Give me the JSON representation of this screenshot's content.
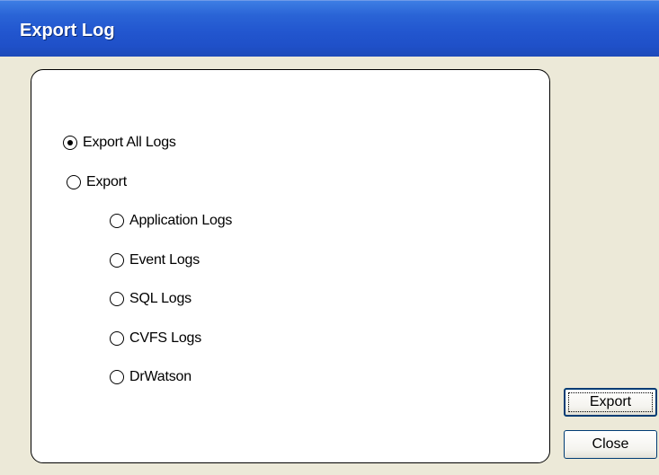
{
  "window": {
    "title": "Export Log"
  },
  "options": {
    "export_all_label": "Export All Logs",
    "export_label": "Export",
    "selected": "export_all",
    "sub_options": [
      {
        "label": "Application Logs",
        "checked": false
      },
      {
        "label": "Event Logs",
        "checked": false
      },
      {
        "label": "SQL Logs",
        "checked": false
      },
      {
        "label": "CVFS Logs",
        "checked": false
      },
      {
        "label": "DrWatson",
        "checked": false
      }
    ]
  },
  "buttons": {
    "export_label": "Export",
    "close_label": "Close"
  }
}
